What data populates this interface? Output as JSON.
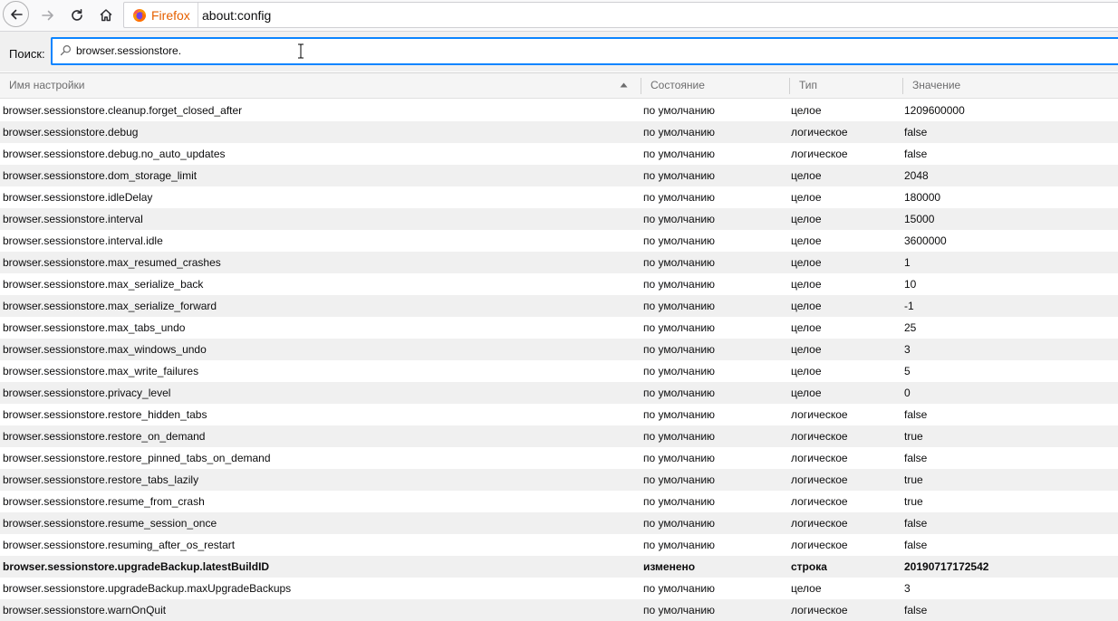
{
  "toolbar": {
    "identity_label": "Firefox",
    "url": "about:config"
  },
  "search": {
    "label": "Поиск:",
    "value": "browser.sessionstore."
  },
  "columns": {
    "name": "Имя настройки",
    "status": "Состояние",
    "type": "Тип",
    "value": "Значение"
  },
  "rows": [
    {
      "name": "browser.sessionstore.cleanup.forget_closed_after",
      "status": "по умолчанию",
      "type": "целое",
      "value": "1209600000"
    },
    {
      "name": "browser.sessionstore.debug",
      "status": "по умолчанию",
      "type": "логическое",
      "value": "false"
    },
    {
      "name": "browser.sessionstore.debug.no_auto_updates",
      "status": "по умолчанию",
      "type": "логическое",
      "value": "false"
    },
    {
      "name": "browser.sessionstore.dom_storage_limit",
      "status": "по умолчанию",
      "type": "целое",
      "value": "2048"
    },
    {
      "name": "browser.sessionstore.idleDelay",
      "status": "по умолчанию",
      "type": "целое",
      "value": "180000"
    },
    {
      "name": "browser.sessionstore.interval",
      "status": "по умолчанию",
      "type": "целое",
      "value": "15000"
    },
    {
      "name": "browser.sessionstore.interval.idle",
      "status": "по умолчанию",
      "type": "целое",
      "value": "3600000"
    },
    {
      "name": "browser.sessionstore.max_resumed_crashes",
      "status": "по умолчанию",
      "type": "целое",
      "value": "1"
    },
    {
      "name": "browser.sessionstore.max_serialize_back",
      "status": "по умолчанию",
      "type": "целое",
      "value": "10"
    },
    {
      "name": "browser.sessionstore.max_serialize_forward",
      "status": "по умолчанию",
      "type": "целое",
      "value": "-1"
    },
    {
      "name": "browser.sessionstore.max_tabs_undo",
      "status": "по умолчанию",
      "type": "целое",
      "value": "25"
    },
    {
      "name": "browser.sessionstore.max_windows_undo",
      "status": "по умолчанию",
      "type": "целое",
      "value": "3"
    },
    {
      "name": "browser.sessionstore.max_write_failures",
      "status": "по умолчанию",
      "type": "целое",
      "value": "5"
    },
    {
      "name": "browser.sessionstore.privacy_level",
      "status": "по умолчанию",
      "type": "целое",
      "value": "0"
    },
    {
      "name": "browser.sessionstore.restore_hidden_tabs",
      "status": "по умолчанию",
      "type": "логическое",
      "value": "false"
    },
    {
      "name": "browser.sessionstore.restore_on_demand",
      "status": "по умолчанию",
      "type": "логическое",
      "value": "true"
    },
    {
      "name": "browser.sessionstore.restore_pinned_tabs_on_demand",
      "status": "по умолчанию",
      "type": "логическое",
      "value": "false"
    },
    {
      "name": "browser.sessionstore.restore_tabs_lazily",
      "status": "по умолчанию",
      "type": "логическое",
      "value": "true"
    },
    {
      "name": "browser.sessionstore.resume_from_crash",
      "status": "по умолчанию",
      "type": "логическое",
      "value": "true"
    },
    {
      "name": "browser.sessionstore.resume_session_once",
      "status": "по умолчанию",
      "type": "логическое",
      "value": "false"
    },
    {
      "name": "browser.sessionstore.resuming_after_os_restart",
      "status": "по умолчанию",
      "type": "логическое",
      "value": "false"
    },
    {
      "name": "browser.sessionstore.upgradeBackup.latestBuildID",
      "status": "изменено",
      "type": "строка",
      "value": "20190717172542",
      "modified": true
    },
    {
      "name": "browser.sessionstore.upgradeBackup.maxUpgradeBackups",
      "status": "по умолчанию",
      "type": "целое",
      "value": "3"
    },
    {
      "name": "browser.sessionstore.warnOnQuit",
      "status": "по умолчанию",
      "type": "логическое",
      "value": "false"
    }
  ]
}
